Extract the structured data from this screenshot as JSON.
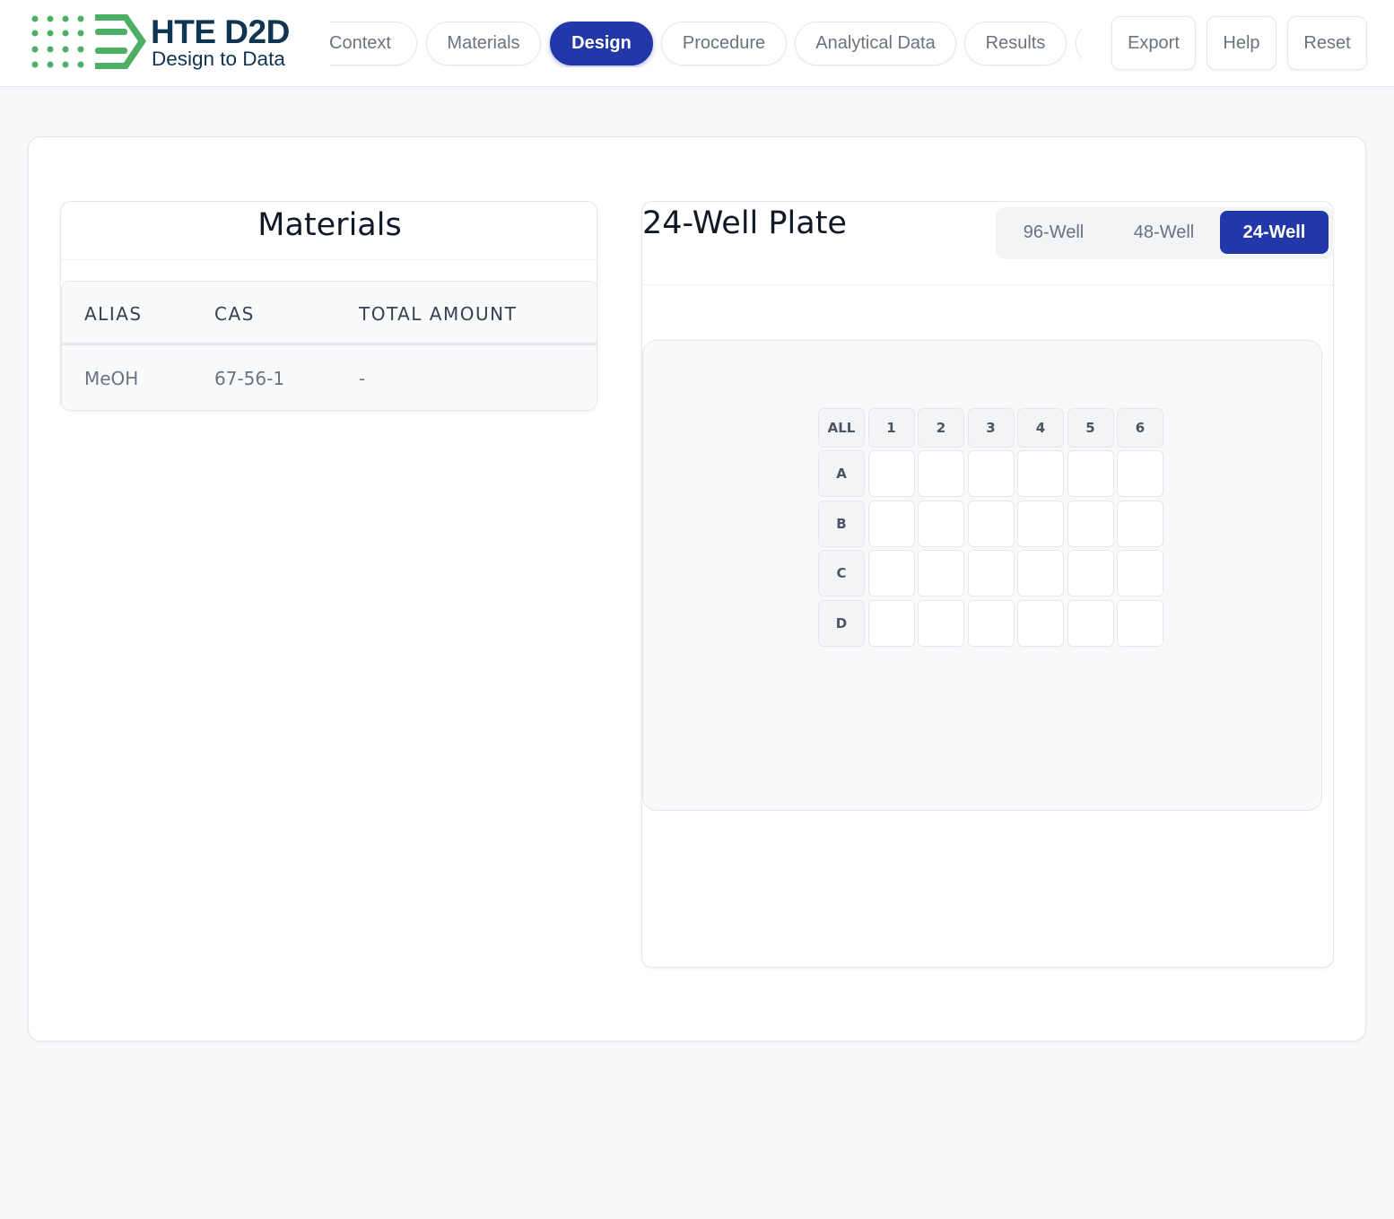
{
  "brand": {
    "title": "HTE D2D",
    "subtitle": "Design to Data",
    "colors": {
      "primary": "#0f3550",
      "accent": "#4caf64"
    }
  },
  "nav": {
    "tabs": [
      {
        "label": "Context",
        "active": false
      },
      {
        "label": "Materials",
        "active": false
      },
      {
        "label": "Design",
        "active": true
      },
      {
        "label": "Procedure",
        "active": false
      },
      {
        "label": "Analytical Data",
        "active": false
      },
      {
        "label": "Results",
        "active": false
      }
    ],
    "actions": {
      "export": "Export",
      "help": "Help",
      "reset": "Reset"
    },
    "active_color": "#2338a8"
  },
  "materials": {
    "title": "Materials",
    "columns": [
      "ALIAS",
      "CAS",
      "TOTAL AMOUNT"
    ],
    "rows": [
      {
        "alias": "MeOH",
        "cas": "67-56-1",
        "total_amount": "-"
      }
    ]
  },
  "plate": {
    "title": "24-Well Plate",
    "formats": [
      {
        "label": "96-Well",
        "active": false
      },
      {
        "label": "48-Well",
        "active": false
      },
      {
        "label": "24-Well",
        "active": true
      }
    ],
    "all_label": "ALL",
    "columns": [
      "1",
      "2",
      "3",
      "4",
      "5",
      "6"
    ],
    "rows": [
      "A",
      "B",
      "C",
      "D"
    ]
  }
}
